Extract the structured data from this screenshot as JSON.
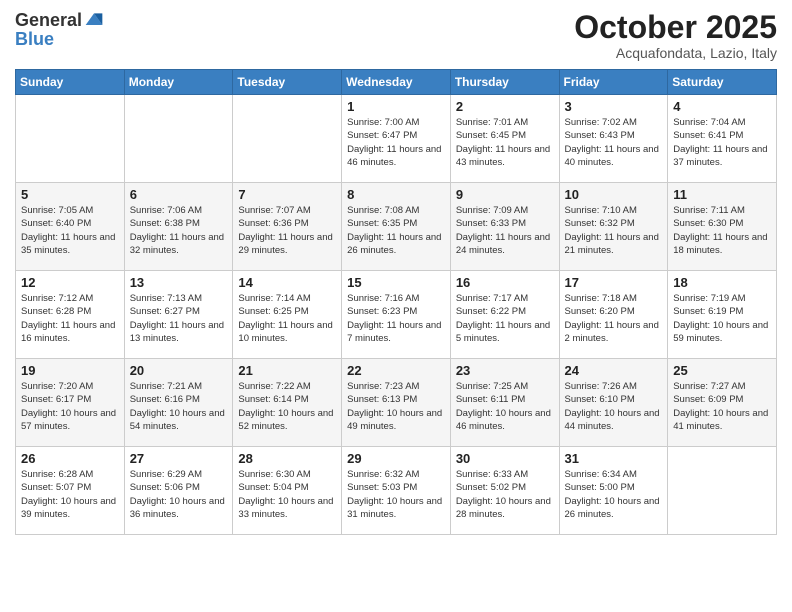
{
  "logo": {
    "general": "General",
    "blue": "Blue"
  },
  "header": {
    "title": "October 2025",
    "subtitle": "Acquafondata, Lazio, Italy"
  },
  "weekdays": [
    "Sunday",
    "Monday",
    "Tuesday",
    "Wednesday",
    "Thursday",
    "Friday",
    "Saturday"
  ],
  "weeks": [
    [
      {
        "day": "",
        "sunrise": "",
        "sunset": "",
        "daylight": ""
      },
      {
        "day": "",
        "sunrise": "",
        "sunset": "",
        "daylight": ""
      },
      {
        "day": "",
        "sunrise": "",
        "sunset": "",
        "daylight": ""
      },
      {
        "day": "1",
        "sunrise": "Sunrise: 7:00 AM",
        "sunset": "Sunset: 6:47 PM",
        "daylight": "Daylight: 11 hours and 46 minutes."
      },
      {
        "day": "2",
        "sunrise": "Sunrise: 7:01 AM",
        "sunset": "Sunset: 6:45 PM",
        "daylight": "Daylight: 11 hours and 43 minutes."
      },
      {
        "day": "3",
        "sunrise": "Sunrise: 7:02 AM",
        "sunset": "Sunset: 6:43 PM",
        "daylight": "Daylight: 11 hours and 40 minutes."
      },
      {
        "day": "4",
        "sunrise": "Sunrise: 7:04 AM",
        "sunset": "Sunset: 6:41 PM",
        "daylight": "Daylight: 11 hours and 37 minutes."
      }
    ],
    [
      {
        "day": "5",
        "sunrise": "Sunrise: 7:05 AM",
        "sunset": "Sunset: 6:40 PM",
        "daylight": "Daylight: 11 hours and 35 minutes."
      },
      {
        "day": "6",
        "sunrise": "Sunrise: 7:06 AM",
        "sunset": "Sunset: 6:38 PM",
        "daylight": "Daylight: 11 hours and 32 minutes."
      },
      {
        "day": "7",
        "sunrise": "Sunrise: 7:07 AM",
        "sunset": "Sunset: 6:36 PM",
        "daylight": "Daylight: 11 hours and 29 minutes."
      },
      {
        "day": "8",
        "sunrise": "Sunrise: 7:08 AM",
        "sunset": "Sunset: 6:35 PM",
        "daylight": "Daylight: 11 hours and 26 minutes."
      },
      {
        "day": "9",
        "sunrise": "Sunrise: 7:09 AM",
        "sunset": "Sunset: 6:33 PM",
        "daylight": "Daylight: 11 hours and 24 minutes."
      },
      {
        "day": "10",
        "sunrise": "Sunrise: 7:10 AM",
        "sunset": "Sunset: 6:32 PM",
        "daylight": "Daylight: 11 hours and 21 minutes."
      },
      {
        "day": "11",
        "sunrise": "Sunrise: 7:11 AM",
        "sunset": "Sunset: 6:30 PM",
        "daylight": "Daylight: 11 hours and 18 minutes."
      }
    ],
    [
      {
        "day": "12",
        "sunrise": "Sunrise: 7:12 AM",
        "sunset": "Sunset: 6:28 PM",
        "daylight": "Daylight: 11 hours and 16 minutes."
      },
      {
        "day": "13",
        "sunrise": "Sunrise: 7:13 AM",
        "sunset": "Sunset: 6:27 PM",
        "daylight": "Daylight: 11 hours and 13 minutes."
      },
      {
        "day": "14",
        "sunrise": "Sunrise: 7:14 AM",
        "sunset": "Sunset: 6:25 PM",
        "daylight": "Daylight: 11 hours and 10 minutes."
      },
      {
        "day": "15",
        "sunrise": "Sunrise: 7:16 AM",
        "sunset": "Sunset: 6:23 PM",
        "daylight": "Daylight: 11 hours and 7 minutes."
      },
      {
        "day": "16",
        "sunrise": "Sunrise: 7:17 AM",
        "sunset": "Sunset: 6:22 PM",
        "daylight": "Daylight: 11 hours and 5 minutes."
      },
      {
        "day": "17",
        "sunrise": "Sunrise: 7:18 AM",
        "sunset": "Sunset: 6:20 PM",
        "daylight": "Daylight: 11 hours and 2 minutes."
      },
      {
        "day": "18",
        "sunrise": "Sunrise: 7:19 AM",
        "sunset": "Sunset: 6:19 PM",
        "daylight": "Daylight: 10 hours and 59 minutes."
      }
    ],
    [
      {
        "day": "19",
        "sunrise": "Sunrise: 7:20 AM",
        "sunset": "Sunset: 6:17 PM",
        "daylight": "Daylight: 10 hours and 57 minutes."
      },
      {
        "day": "20",
        "sunrise": "Sunrise: 7:21 AM",
        "sunset": "Sunset: 6:16 PM",
        "daylight": "Daylight: 10 hours and 54 minutes."
      },
      {
        "day": "21",
        "sunrise": "Sunrise: 7:22 AM",
        "sunset": "Sunset: 6:14 PM",
        "daylight": "Daylight: 10 hours and 52 minutes."
      },
      {
        "day": "22",
        "sunrise": "Sunrise: 7:23 AM",
        "sunset": "Sunset: 6:13 PM",
        "daylight": "Daylight: 10 hours and 49 minutes."
      },
      {
        "day": "23",
        "sunrise": "Sunrise: 7:25 AM",
        "sunset": "Sunset: 6:11 PM",
        "daylight": "Daylight: 10 hours and 46 minutes."
      },
      {
        "day": "24",
        "sunrise": "Sunrise: 7:26 AM",
        "sunset": "Sunset: 6:10 PM",
        "daylight": "Daylight: 10 hours and 44 minutes."
      },
      {
        "day": "25",
        "sunrise": "Sunrise: 7:27 AM",
        "sunset": "Sunset: 6:09 PM",
        "daylight": "Daylight: 10 hours and 41 minutes."
      }
    ],
    [
      {
        "day": "26",
        "sunrise": "Sunrise: 6:28 AM",
        "sunset": "Sunset: 5:07 PM",
        "daylight": "Daylight: 10 hours and 39 minutes."
      },
      {
        "day": "27",
        "sunrise": "Sunrise: 6:29 AM",
        "sunset": "Sunset: 5:06 PM",
        "daylight": "Daylight: 10 hours and 36 minutes."
      },
      {
        "day": "28",
        "sunrise": "Sunrise: 6:30 AM",
        "sunset": "Sunset: 5:04 PM",
        "daylight": "Daylight: 10 hours and 33 minutes."
      },
      {
        "day": "29",
        "sunrise": "Sunrise: 6:32 AM",
        "sunset": "Sunset: 5:03 PM",
        "daylight": "Daylight: 10 hours and 31 minutes."
      },
      {
        "day": "30",
        "sunrise": "Sunrise: 6:33 AM",
        "sunset": "Sunset: 5:02 PM",
        "daylight": "Daylight: 10 hours and 28 minutes."
      },
      {
        "day": "31",
        "sunrise": "Sunrise: 6:34 AM",
        "sunset": "Sunset: 5:00 PM",
        "daylight": "Daylight: 10 hours and 26 minutes."
      },
      {
        "day": "",
        "sunrise": "",
        "sunset": "",
        "daylight": ""
      }
    ]
  ]
}
